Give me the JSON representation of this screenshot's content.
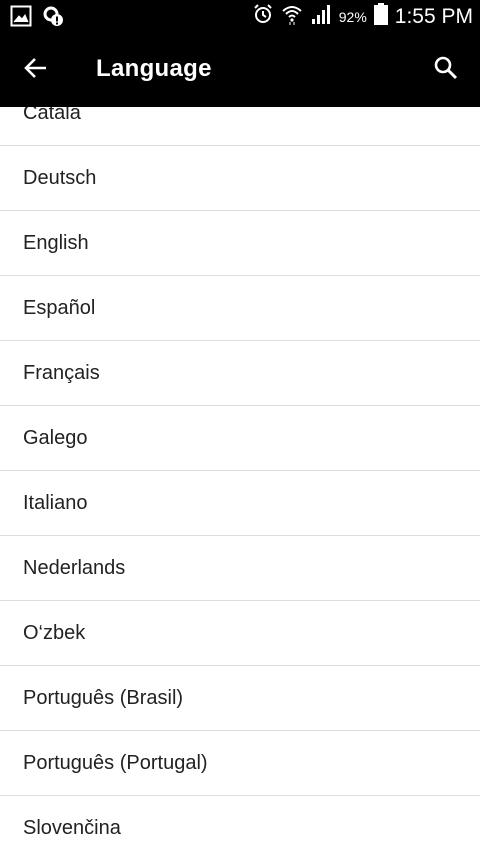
{
  "status_bar": {
    "battery_percent": "92%",
    "time": "1:55 PM",
    "icons": [
      "gallery-icon",
      "settings-badge-icon",
      "alarm-icon",
      "wifi-icon",
      "signal-icon",
      "battery-icon"
    ]
  },
  "app_bar": {
    "title": "Language",
    "back_icon": "arrow-left-icon",
    "search_icon": "search-icon"
  },
  "languages": [
    "Català",
    "Deutsch",
    "English",
    "Español",
    "Français",
    "Galego",
    "Italiano",
    "Nederlands",
    "O‘zbek",
    "Português (Brasil)",
    "Português (Portugal)",
    "Slovenčina"
  ]
}
